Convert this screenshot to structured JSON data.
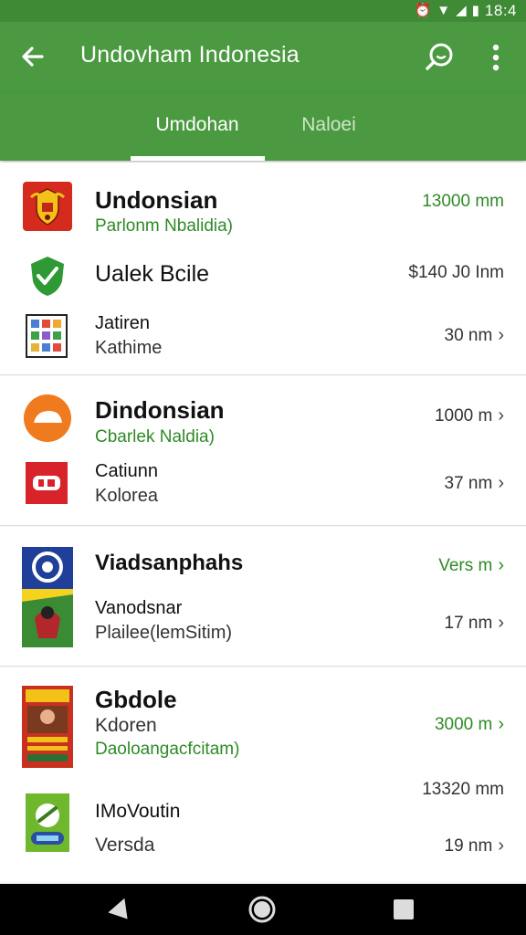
{
  "status_bar": {
    "time": "18:4",
    "icons": [
      "alarm-icon",
      "wifi-icon",
      "signal-icon",
      "battery-icon"
    ]
  },
  "app_bar": {
    "title": "Undovham Indonesia",
    "icons": [
      "back-arrow-icon",
      "search-icon",
      "more-vert-icon"
    ]
  },
  "tabs": [
    {
      "label": "Umdohan",
      "active": true
    },
    {
      "label": "Naloei",
      "active": false
    }
  ],
  "groups": [
    {
      "rows": [
        {
          "icon": "emblem-icon",
          "title": "Undonsian",
          "subtitle": "Parlonm Nbalidia)",
          "value": "13000 mm"
        },
        {
          "icon": "green-check-shield-icon",
          "title": "Ualek Bcile",
          "subtitle": "",
          "value": "$140 J0 Inm"
        },
        {
          "icon": "app-grid-icon",
          "title": "Jatiren",
          "subtitle": "Kathime",
          "value": "30 nm"
        }
      ]
    },
    {
      "rows": [
        {
          "icon": "orange-circle-icon",
          "title": "Dindonsian",
          "subtitle": "Cbarlek Naldia)",
          "value": "1000 m"
        },
        {
          "icon": "red-ticket-icon",
          "title": "Catiunn",
          "subtitle": "Kolorea",
          "value": "37 nm"
        }
      ]
    },
    {
      "rows": [
        {
          "icon": "blue-logo-poster-icon",
          "title": "Viadsanphahs",
          "subtitle": "",
          "value": "Vers m"
        },
        {
          "icon": "",
          "title": "Vanodsnar",
          "subtitle": "Plailee(lemSitim)",
          "value": "17 nm"
        }
      ]
    },
    {
      "rows": [
        {
          "icon": "book-cover-icon",
          "title": "Gbdole",
          "subtitle": "Kdoren",
          "subtitle2": "Daoloangacfcitam)",
          "value": "3000 m"
        },
        {
          "icon": "green-game-icon",
          "title": "IMoVoutin",
          "subtitle": "Versda",
          "value_top": "13320 mm",
          "value": "19 nm"
        }
      ]
    }
  ],
  "colors": {
    "appbar": "#4b9a41",
    "statusbar": "#3f8a34",
    "accent_green": "#2f8a27"
  },
  "nav_bar": {
    "icons": [
      "back-triangle-icon",
      "home-circle-icon",
      "recents-square-icon"
    ]
  }
}
